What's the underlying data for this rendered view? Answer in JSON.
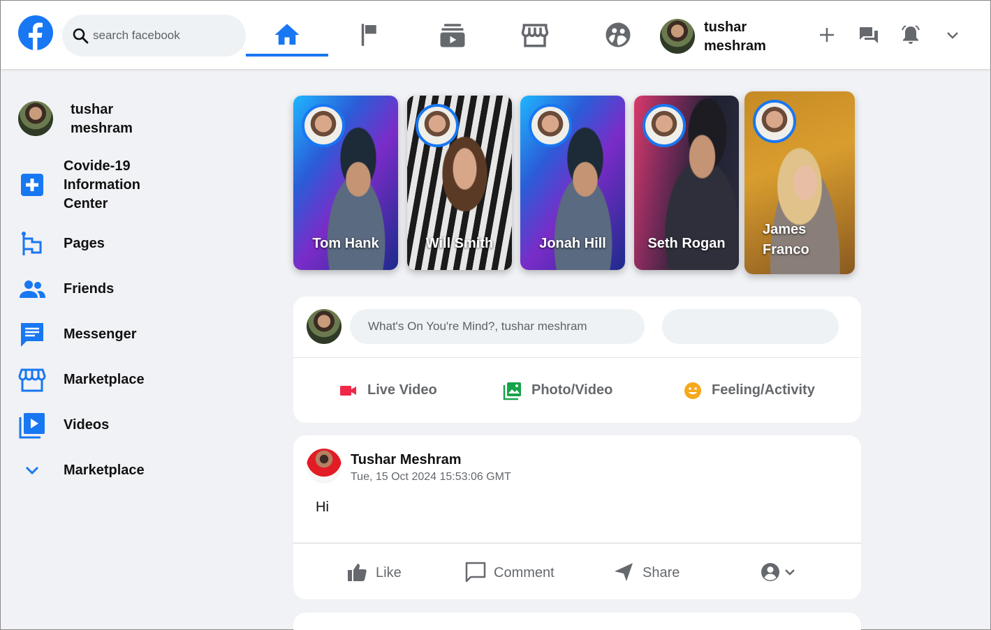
{
  "header": {
    "search_placeholder": "search facebook",
    "nav_tabs": [
      {
        "name": "home",
        "active": true
      },
      {
        "name": "pages",
        "active": false
      },
      {
        "name": "watch",
        "active": false
      },
      {
        "name": "marketplace",
        "active": false
      },
      {
        "name": "groups",
        "active": false
      }
    ],
    "profile_name": "tushar meshram",
    "actions": [
      "plus-icon",
      "messenger-icon",
      "notifications-icon",
      "chevron-down-icon"
    ]
  },
  "sidebar": {
    "profile_name": "tushar meshram",
    "items": [
      {
        "label": "Covide-19 Information Center",
        "icon": "covid-plus-icon"
      },
      {
        "label": "Pages",
        "icon": "flag-icon"
      },
      {
        "label": "Friends",
        "icon": "friends-icon"
      },
      {
        "label": "Messenger",
        "icon": "message-icon"
      },
      {
        "label": "Marketplace",
        "icon": "store-icon"
      },
      {
        "label": "Videos",
        "icon": "video-library-icon"
      },
      {
        "label": "Marketplace",
        "icon": "chevron-down-icon"
      }
    ]
  },
  "stories": [
    {
      "name": "Tom Hank"
    },
    {
      "name": "Will Smith"
    },
    {
      "name": "Jonah Hill"
    },
    {
      "name": "Seth Rogan"
    },
    {
      "name": "James Franco"
    }
  ],
  "create_post": {
    "placeholder": "What's On You're Mind?, tushar meshram",
    "actions": [
      {
        "label": "Live Video",
        "icon": "live-video-icon",
        "color": "#f02849"
      },
      {
        "label": "Photo/Video",
        "icon": "photo-icon",
        "color": "#45bd62"
      },
      {
        "label": "Feeling/Activity",
        "icon": "feeling-icon",
        "color": "#f7b928"
      }
    ]
  },
  "post": {
    "author": "Tushar Meshram",
    "timestamp": "Tue, 15 Oct 2024 15:53:06 GMT",
    "body": "Hi",
    "actions": [
      {
        "label": "Like",
        "icon": "thumbs-up-icon"
      },
      {
        "label": "Comment",
        "icon": "comment-icon"
      },
      {
        "label": "Share",
        "icon": "share-icon"
      }
    ]
  },
  "colors": {
    "brand": "#1877f2",
    "background": "#f1f2f5",
    "muted_text": "#65686c"
  }
}
